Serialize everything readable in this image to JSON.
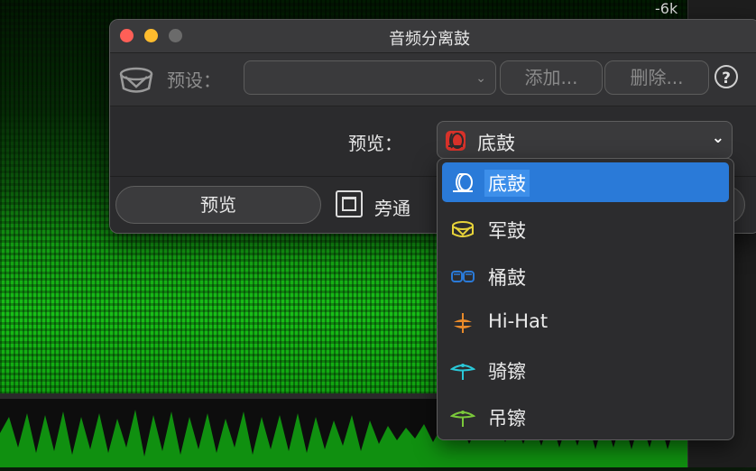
{
  "background": {
    "scale_label": "-6k"
  },
  "dialog": {
    "title": "音频分离鼓",
    "preset": {
      "label": "预设：",
      "value": "",
      "add_label": "添加...",
      "delete_label": "删除...",
      "help_glyph": "?"
    },
    "preview": {
      "label": "预览：",
      "selected": "底鼓"
    },
    "bottom": {
      "preview_button": "预览",
      "bypass_label": "旁通"
    }
  },
  "dropdown": {
    "items": [
      {
        "label": "底鼓",
        "icon": "kick-drum-icon",
        "color": "#ffffff",
        "selected": true
      },
      {
        "label": "军鼓",
        "icon": "snare-drum-icon",
        "color": "#e8d43a",
        "selected": false
      },
      {
        "label": "桶鼓",
        "icon": "tom-drums-icon",
        "color": "#2a7ad8",
        "selected": false
      },
      {
        "label": "Hi-Hat",
        "icon": "hi-hat-icon",
        "color": "#e88a2a",
        "selected": false
      },
      {
        "label": "骑镲",
        "icon": "ride-cymbal-icon",
        "color": "#2ac8d8",
        "selected": false
      },
      {
        "label": "吊镲",
        "icon": "crash-cymbal-icon",
        "color": "#7ac83a",
        "selected": false
      }
    ]
  },
  "colors": {
    "accent": "#2a7ad8",
    "kick_selected_icon": "#d8322a"
  }
}
